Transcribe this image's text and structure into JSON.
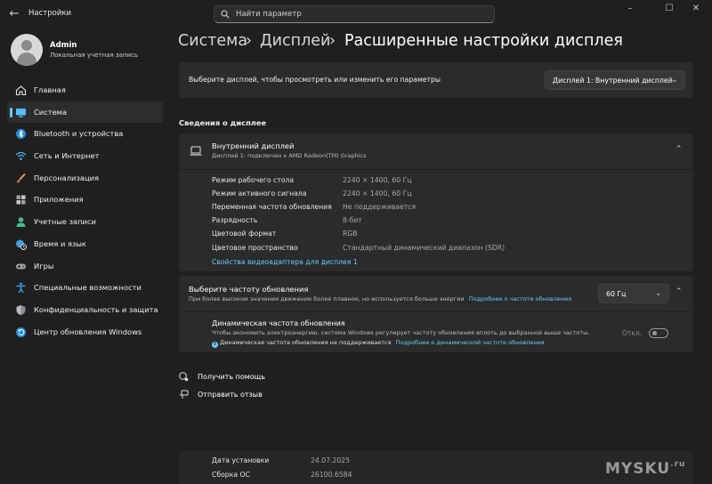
{
  "app_title": "Настройки",
  "search": {
    "placeholder": "Найти параметр"
  },
  "window_controls": {
    "minimize": "–",
    "maximize": "☐",
    "close": "✕"
  },
  "user": {
    "name": "Admin",
    "account_type": "Локальная учетная запись"
  },
  "nav": [
    {
      "label": "Главная",
      "icon": "home-icon"
    },
    {
      "label": "Система",
      "icon": "system-icon",
      "active": true
    },
    {
      "label": "Bluetooth и устройства",
      "icon": "bluetooth-icon"
    },
    {
      "label": "Сеть и Интернет",
      "icon": "wifi-icon"
    },
    {
      "label": "Персонализация",
      "icon": "brush-icon"
    },
    {
      "label": "Приложения",
      "icon": "apps-icon"
    },
    {
      "label": "Учетные записи",
      "icon": "account-icon"
    },
    {
      "label": "Время и язык",
      "icon": "globe-clock-icon"
    },
    {
      "label": "Игры",
      "icon": "gamepad-icon"
    },
    {
      "label": "Специальные возможности",
      "icon": "accessibility-icon"
    },
    {
      "label": "Конфиденциальность и защита",
      "icon": "shield-icon"
    },
    {
      "label": "Центр обновления Windows",
      "icon": "update-icon"
    }
  ],
  "breadcrumb": {
    "part1": "Система",
    "part2": "Дисплей",
    "part3": "Расширенные настройки дисплея",
    "sep": "›"
  },
  "display_select": {
    "label": "Выберите дисплей, чтобы просмотреть или изменить его параметры",
    "value": "Дисплей 1: Внутренний дисплей"
  },
  "section_title": "Сведения о дисплее",
  "display_info": {
    "title": "Внутренний дисплей",
    "subtitle": "Дисплей 1: подключен к AMD Radeon(TM) Graphics",
    "rows": [
      {
        "label": "Режим рабочего стола",
        "value": "2240 × 1400, 60 Гц"
      },
      {
        "label": "Режим активного сигнала",
        "value": "2240 × 1400, 60 Гц"
      },
      {
        "label": "Переменная частота обновления",
        "value": "Не поддерживается"
      },
      {
        "label": "Разрядность",
        "value": "8-бит"
      },
      {
        "label": "Цветовой формат",
        "value": "RGB"
      },
      {
        "label": "Цветовое пространство",
        "value": "Стандартный динамический диапазон (SDR)"
      }
    ],
    "adapter_link": "Свойства видеоадаптера для дисплея 1"
  },
  "refresh": {
    "title": "Выберите частоту обновления",
    "desc": "При более высоком значении движение более плавное, но используется больше энергии",
    "link": "Подробнее о частоте обновления",
    "value": "60 Гц"
  },
  "dynamic": {
    "title": "Динамическая частота обновления",
    "desc": "Чтобы экономить электроэнергию, система Windows регулирует частоту обновления вплоть до выбранной выше частоты.",
    "note": "Динамическая частота обновления не поддерживается",
    "link": "Подробнее о динамической частоте обновления",
    "toggle_label": "Откл.",
    "toggle_on": false
  },
  "help": {
    "get_help": "Получить помощь",
    "feedback": "Отправить отзыв"
  },
  "overlay": {
    "rows": [
      {
        "label": "Дата установки",
        "value": "24.07.2025"
      },
      {
        "label": "Сборка ОС",
        "value": "26100.6584"
      }
    ],
    "watermark": "MYSKU",
    "watermark_suffix": ".ru"
  },
  "colors": {
    "accent": "#60cdff",
    "bg": "#1f1f1f",
    "card": "#2b2b2b"
  }
}
